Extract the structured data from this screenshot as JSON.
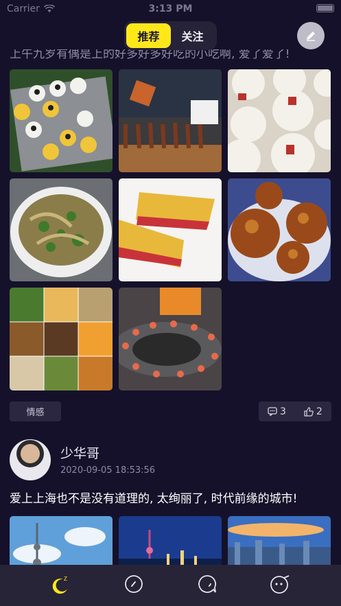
{
  "status": {
    "carrier": "Carrier",
    "time": "3:13 PM"
  },
  "header": {
    "tabs": [
      {
        "label": "推荐",
        "active": true
      },
      {
        "label": "关注",
        "active": false
      }
    ]
  },
  "post1": {
    "text_fragment": "上午九岁有偶是上的好多好多好吃的小吃啊, 爱了爱了!",
    "tag": "情感",
    "comment_count": "3",
    "like_count": "2",
    "images": [
      "sushi-tray",
      "bbq-skewers",
      "rice-cakes",
      "noodle-soup",
      "sandwich",
      "fried-cakes",
      "food-collage",
      "grilled-shrimp"
    ]
  },
  "post2": {
    "username": "少华哥",
    "time": "2020-09-05 18:53:56",
    "text": "爱上上海也不是没有道理的, 太绚丽了, 时代前缘的城市!",
    "images": [
      "pearl-tower-day",
      "bund-night",
      "skyline-aerial"
    ]
  },
  "tabbar": {
    "items": [
      "home-moon-icon",
      "discover-compass-icon",
      "message-bubble-icon",
      "profile-face-icon"
    ]
  },
  "colors": {
    "accent": "#ffe81a",
    "background": "#15112a",
    "tabbar": "#282437"
  }
}
